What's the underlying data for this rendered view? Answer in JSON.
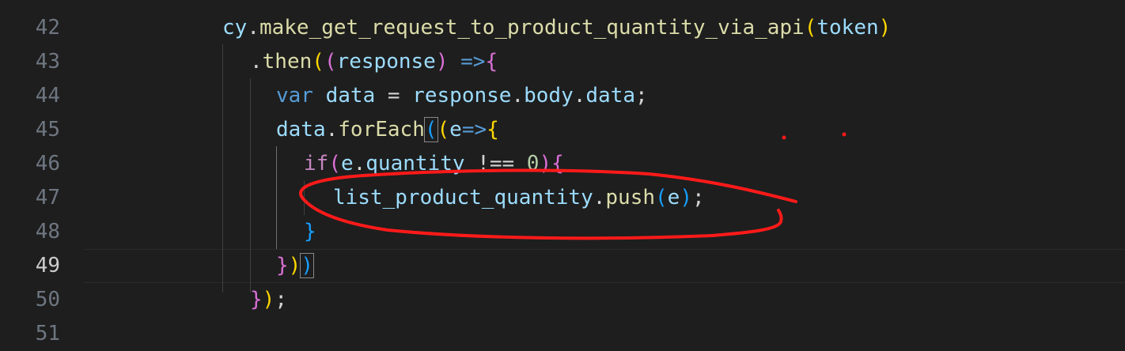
{
  "editor": {
    "line_numbers": [
      "42",
      "43",
      "44",
      "45",
      "46",
      "47",
      "48",
      "49",
      "50",
      "51"
    ],
    "active_line": "49",
    "lines": {
      "l42": {
        "cy": "cy",
        "dot": ".",
        "fn": "make_get_request_to_product_quantity_via_api",
        "open": "(",
        "arg": "token",
        "close": ")"
      },
      "l43": {
        "dot": ".",
        "fn": "then",
        "open1": "(",
        "open2": "(",
        "param": "response",
        "close2": ")",
        "arrow": " =>",
        "brace": "{"
      },
      "l44": {
        "kw": "var",
        "name": "data",
        "eq": " = ",
        "obj": "response",
        "dot1": ".",
        "prop1": "body",
        "dot2": ".",
        "prop2": "data",
        "semi": ";"
      },
      "l45": {
        "obj": "data",
        "dot": ".",
        "fn": "forEach",
        "open1": "(",
        "open2": "(",
        "param": "e",
        "arrow": "=>",
        "brace": "{"
      },
      "l46": {
        "kw": "if",
        "open": "(",
        "obj": "e",
        "dot": ".",
        "prop": "quantity",
        "op": " !== ",
        "num": "0",
        "close": ")",
        "brace": "{"
      },
      "l47": {
        "obj": "list_product_quantity",
        "dot": ".",
        "fn": "push",
        "open": "(",
        "arg": "e",
        "close": ")",
        "semi": ";"
      },
      "l48": {
        "brace": "}"
      },
      "l49": {
        "brace": "}",
        "close1": ")",
        "close2": ")"
      },
      "l50": {
        "brace": "}",
        "close": ")",
        "semi": ";"
      }
    }
  },
  "colors": {
    "background": "#1e1e1e",
    "annotation_stroke": "#ff1a1a"
  }
}
